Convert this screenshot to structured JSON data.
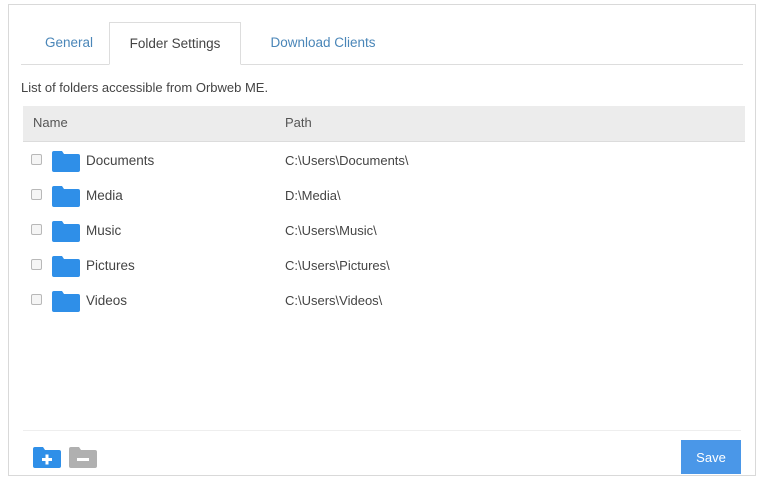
{
  "tabs": [
    {
      "label": "General",
      "active": false
    },
    {
      "label": "Folder Settings",
      "active": true
    },
    {
      "label": "Download Clients",
      "active": false
    }
  ],
  "description": "List of folders accessible from Orbweb ME.",
  "table": {
    "columns": [
      "Name",
      "Path"
    ],
    "rows": [
      {
        "name": "Documents",
        "path": "C:\\Users\\Documents\\",
        "checked": false
      },
      {
        "name": "Media",
        "path": "D:\\Media\\",
        "checked": false
      },
      {
        "name": "Music",
        "path": "C:\\Users\\Music\\",
        "checked": false
      },
      {
        "name": "Pictures",
        "path": "C:\\Users\\Pictures\\",
        "checked": false
      },
      {
        "name": "Videos",
        "path": "C:\\Users\\Videos\\",
        "checked": false
      }
    ]
  },
  "footer": {
    "add_icon": "folder-add-icon",
    "remove_icon": "folder-remove-icon",
    "save_label": "Save"
  },
  "colors": {
    "accent": "#4a97e8",
    "folder": "#2f8fe8",
    "tab_link": "#4a86b8",
    "header_bg": "#ececec"
  }
}
